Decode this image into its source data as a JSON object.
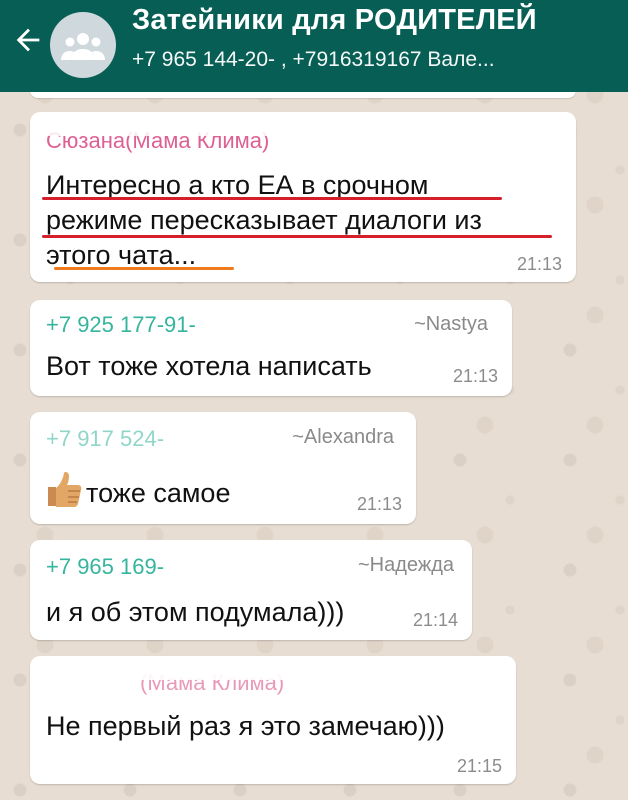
{
  "header": {
    "title": "Затейники для РОДИТЕЛЕЙ",
    "subtitle": "+7 965 144-20-  , +7916319167  Вале..."
  },
  "messages": [
    {
      "sender": "Сюзана(Мама Клима)",
      "lines": [
        "Интересно а кто ЕА в срочном",
        "режиме пересказывает диалоги из",
        "этого чата..."
      ],
      "time": "21:13"
    },
    {
      "sender": "+7 925 177-91-",
      "alias": "~Nastya",
      "text": "Вот тоже хотела написать",
      "time": "21:13"
    },
    {
      "sender": "+7 917 524-",
      "alias": "~Alexandra",
      "text": "тоже самое",
      "time": "21:13"
    },
    {
      "sender": "+7 965 169-",
      "alias": "~Надежда",
      "text": "и я об этом подумала)))",
      "time": "21:14"
    },
    {
      "sender": "(Мама Клима)",
      "text": "Не первый раз я это замечаю)))",
      "time": "21:15"
    }
  ],
  "colors": {
    "header": "#075e54",
    "sender_green": "#35b59d",
    "sender_pink": "#d9447e",
    "underline_red": "#d5202a",
    "underline_orange": "#f07b1f"
  },
  "icons": {
    "back": "arrow-left-icon",
    "avatar": "group-avatar-icon",
    "emoji": "thumbs-up-icon"
  }
}
